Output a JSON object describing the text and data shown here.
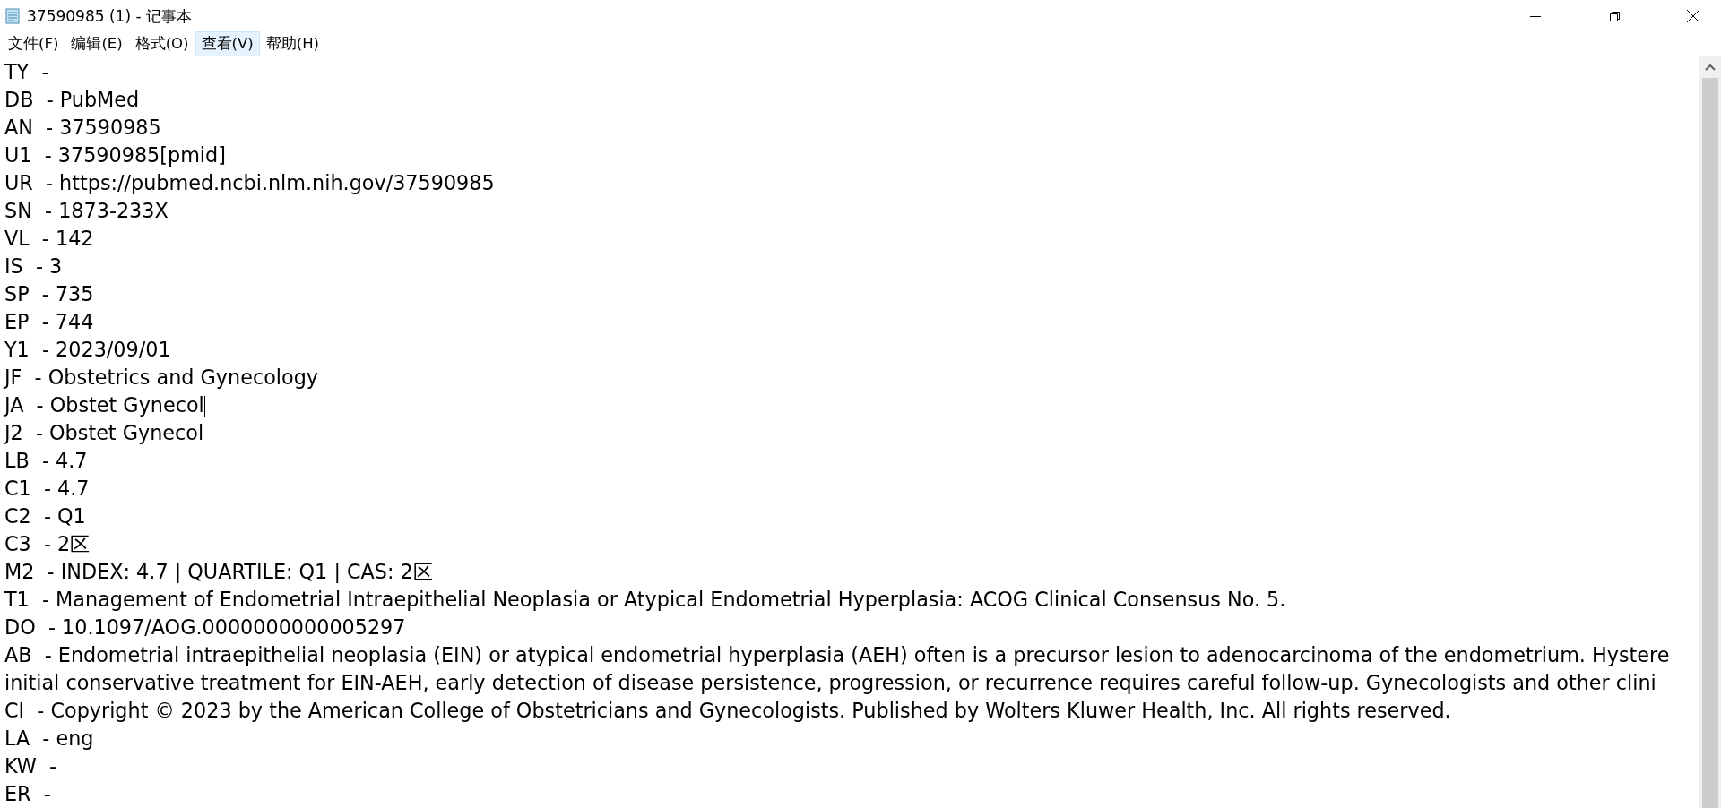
{
  "window": {
    "title": "37590985 (1) - 记事本"
  },
  "menu": [
    {
      "label": "文件(F)",
      "selected": false
    },
    {
      "label": "编辑(E)",
      "selected": false
    },
    {
      "label": "格式(O)",
      "selected": false
    },
    {
      "label": "查看(V)",
      "selected": true
    },
    {
      "label": "帮助(H)",
      "selected": false
    }
  ],
  "lines": [
    {
      "text": "TY  -",
      "caret": false
    },
    {
      "text": "DB  - PubMed",
      "caret": false
    },
    {
      "text": "AN  - 37590985",
      "caret": false
    },
    {
      "text": "U1  - 37590985[pmid]",
      "caret": false
    },
    {
      "text": "UR  - https://pubmed.ncbi.nlm.nih.gov/37590985",
      "caret": false
    },
    {
      "text": "SN  - 1873-233X",
      "caret": false
    },
    {
      "text": "VL  - 142",
      "caret": false
    },
    {
      "text": "IS  - 3",
      "caret": false
    },
    {
      "text": "SP  - 735",
      "caret": false
    },
    {
      "text": "EP  - 744",
      "caret": false
    },
    {
      "text": "Y1  - 2023/09/01",
      "caret": false
    },
    {
      "text": "JF  - Obstetrics and Gynecology",
      "caret": false
    },
    {
      "text": "JA  - Obstet Gynecol",
      "caret": true
    },
    {
      "text": "J2  - Obstet Gynecol",
      "caret": false
    },
    {
      "text": "LB  - 4.7",
      "caret": false
    },
    {
      "text": "C1  - 4.7",
      "caret": false
    },
    {
      "text": "C2  - Q1",
      "caret": false
    },
    {
      "text": "C3  - 2区",
      "caret": false
    },
    {
      "text": "M2  - INDEX: 4.7 | QUARTILE: Q1 | CAS: 2区",
      "caret": false
    },
    {
      "text": "T1  - Management of Endometrial Intraepithelial Neoplasia or Atypical Endometrial Hyperplasia: ACOG Clinical Consensus No. 5.",
      "caret": false
    },
    {
      "text": "DO  - 10.1097/AOG.0000000000005297",
      "caret": false
    },
    {
      "text": "AB  - Endometrial intraepithelial neoplasia (EIN) or atypical endometrial hyperplasia (AEH) often is a precursor lesion to adenocarcinoma of the endometrium. Hystere",
      "caret": false
    },
    {
      "text": "initial conservative treatment for EIN-AEH, early detection of disease persistence, progression, or recurrence requires careful follow-up. Gynecologists and other clini",
      "caret": false
    },
    {
      "text": "CI  - Copyright © 2023 by the American College of Obstetricians and Gynecologists. Published by Wolters Kluwer Health, Inc. All rights reserved.",
      "caret": false
    },
    {
      "text": "LA  - eng",
      "caret": false
    },
    {
      "text": "KW  -",
      "caret": false
    },
    {
      "text": "ER  -",
      "caret": false
    }
  ]
}
